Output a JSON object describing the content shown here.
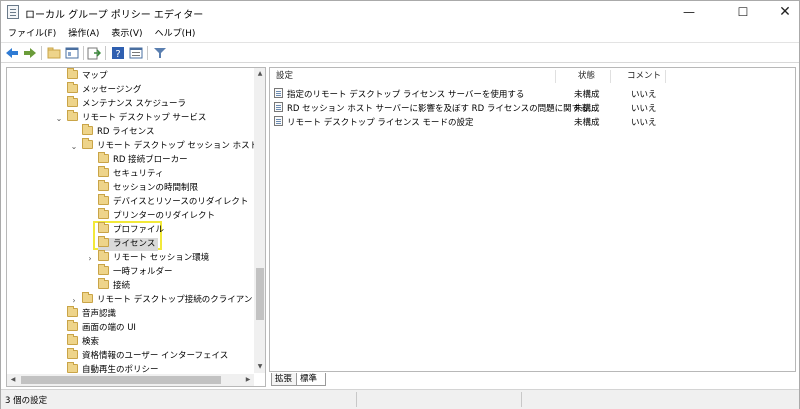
{
  "window": {
    "title": "ローカル グループ ポリシー エディター",
    "minimize": "—",
    "maximize": "☐",
    "close": "✕"
  },
  "menu": [
    "ファイル(F)",
    "操作(A)",
    "表示(V)",
    "ヘルプ(H)"
  ],
  "toolbar": {
    "icons": [
      "back-arrow-icon",
      "forward-arrow-icon",
      "folder-up-icon",
      "show-hide-tree-icon",
      "export-list-icon",
      "help-icon",
      "properties-icon",
      "filter-icon"
    ]
  },
  "tree": [
    {
      "label": "マップ",
      "level": 3,
      "expander": ""
    },
    {
      "label": "メッセージング",
      "level": 3,
      "expander": ""
    },
    {
      "label": "メンテナンス スケジューラ",
      "level": 3,
      "expander": ""
    },
    {
      "label": "リモート デスクトップ サービス",
      "level": 3,
      "expander": "⌄"
    },
    {
      "label": "RD ライセンス",
      "level": 4,
      "expander": ""
    },
    {
      "label": "リモート デスクトップ セッション ホスト",
      "level": 4,
      "expander": "⌄"
    },
    {
      "label": "RD 接続ブローカー",
      "level": 5,
      "expander": ""
    },
    {
      "label": "セキュリティ",
      "level": 5,
      "expander": ""
    },
    {
      "label": "セッションの時間制限",
      "level": 5,
      "expander": ""
    },
    {
      "label": "デバイスとリソースのリダイレクト",
      "level": 5,
      "expander": ""
    },
    {
      "label": "プリンターのリダイレクト",
      "level": 5,
      "expander": ""
    },
    {
      "label": "プロファイル",
      "level": 5,
      "expander": ""
    },
    {
      "label": "ライセンス",
      "level": 5,
      "expander": "",
      "selected": true
    },
    {
      "label": "リモート セッション環境",
      "level": 5,
      "expander": "›"
    },
    {
      "label": "一時フォルダー",
      "level": 5,
      "expander": ""
    },
    {
      "label": "接続",
      "level": 5,
      "expander": ""
    },
    {
      "label": "リモート デスクトップ接続のクライアント",
      "level": 4,
      "expander": "›"
    },
    {
      "label": "音声認識",
      "level": 3,
      "expander": ""
    },
    {
      "label": "画面の端の UI",
      "level": 3,
      "expander": ""
    },
    {
      "label": "検索",
      "level": 3,
      "expander": ""
    },
    {
      "label": "資格情報のユーザー インターフェイス",
      "level": 3,
      "expander": ""
    },
    {
      "label": "自動再生のポリシー",
      "level": 3,
      "expander": ""
    }
  ],
  "list": {
    "headers": {
      "setting": "設定",
      "state": "状態",
      "comment": "コメント"
    },
    "rows": [
      {
        "setting": "指定のリモート デスクトップ ライセンス サーバーを使用する",
        "state": "未構成",
        "comment": "いいえ"
      },
      {
        "setting": "RD セッション ホスト サーバーに影響を及ぼす RD ライセンスの問題に関する...",
        "state": "未構成",
        "comment": "いいえ"
      },
      {
        "setting": "リモート デスクトップ ライセンス モードの設定",
        "state": "未構成",
        "comment": "いいえ"
      }
    ]
  },
  "tabs": [
    "拡張",
    "標準"
  ],
  "status": "3 個の設定"
}
